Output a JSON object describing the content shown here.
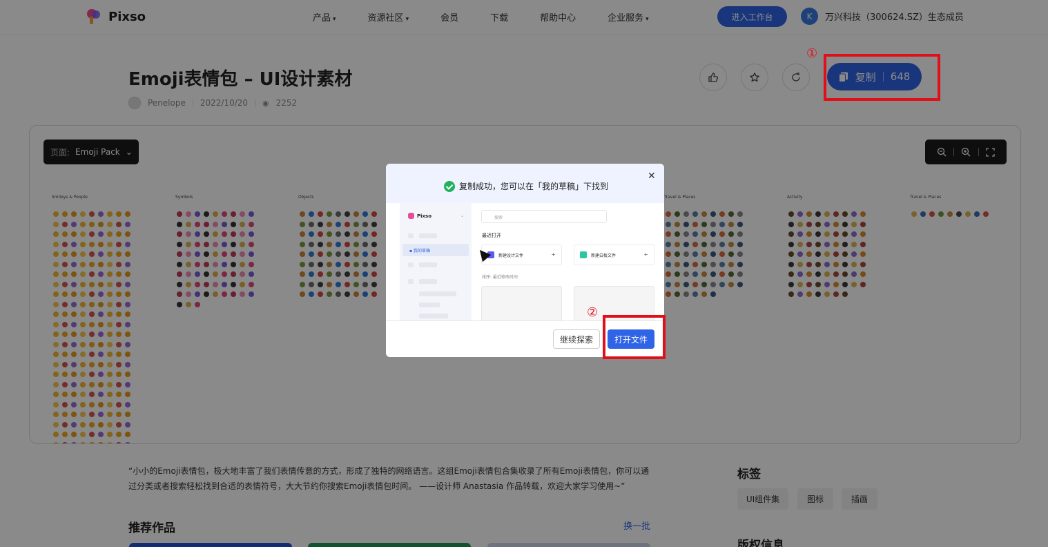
{
  "header": {
    "logo_text": "Pixso",
    "nav": [
      {
        "label": "产品",
        "has_caret": true
      },
      {
        "label": "资源社区",
        "has_caret": true
      },
      {
        "label": "会员",
        "has_caret": false
      },
      {
        "label": "下载",
        "has_caret": false
      },
      {
        "label": "帮助中心",
        "has_caret": false
      },
      {
        "label": "企业服务",
        "has_caret": true
      }
    ],
    "workspace_button": "进入工作台",
    "user_initial": "K",
    "user_label": "万兴科技（300624.SZ）生态成员"
  },
  "resource": {
    "title": "Emoji表情包 – UI设计素材",
    "author": "Penelope",
    "date": "2022/10/20",
    "views": "2252",
    "copy_label": "复制",
    "copy_count": "648"
  },
  "annotations": {
    "marker_1": "①",
    "marker_2": "②",
    "color": "#e0101a"
  },
  "canvas": {
    "page_label": "页面:",
    "page_name": "Emoji Pack",
    "sheets": [
      "Smileys & People",
      "Symbols",
      "Objects",
      "Travel & Places",
      "Activity",
      "Travel & Places"
    ]
  },
  "dialog": {
    "title": "复制成功，您可以在「我的草稿」下找到",
    "preview": {
      "logo": "Pixso",
      "active_item": "我的草稿",
      "search_placeholder": "搜索",
      "recent_label": "最近打开",
      "new_design": "新建设计文件",
      "new_whiteboard": "新建白板文件",
      "sort_label": "排序: 最近修改时间"
    },
    "continue_button": "继续探索",
    "open_button": "打开文件"
  },
  "page": {
    "description": "“小小的Emoji表情包，极大地丰富了我们表情传意的方式，形成了独特的网络语言。这组Emoji表情包合集收录了所有Emoji表情包，你可以通过分类或者搜索轻松找到合适的表情符号，大大节约你搜索Emoji表情包时间。 ——设计师 Anastasia 作品转载，欢迎大家学习使用~”",
    "recommended_title": "推荐作品",
    "refresh_link": "换一批",
    "tags_title": "标签",
    "tags": [
      "UI组件集",
      "图标",
      "插画"
    ],
    "copyright_title": "版权信息"
  },
  "colors": {
    "brand_blue": "#2f64e6",
    "success_green": "#1fb25a",
    "overlay": "rgba(0,0,0,0.46)"
  }
}
